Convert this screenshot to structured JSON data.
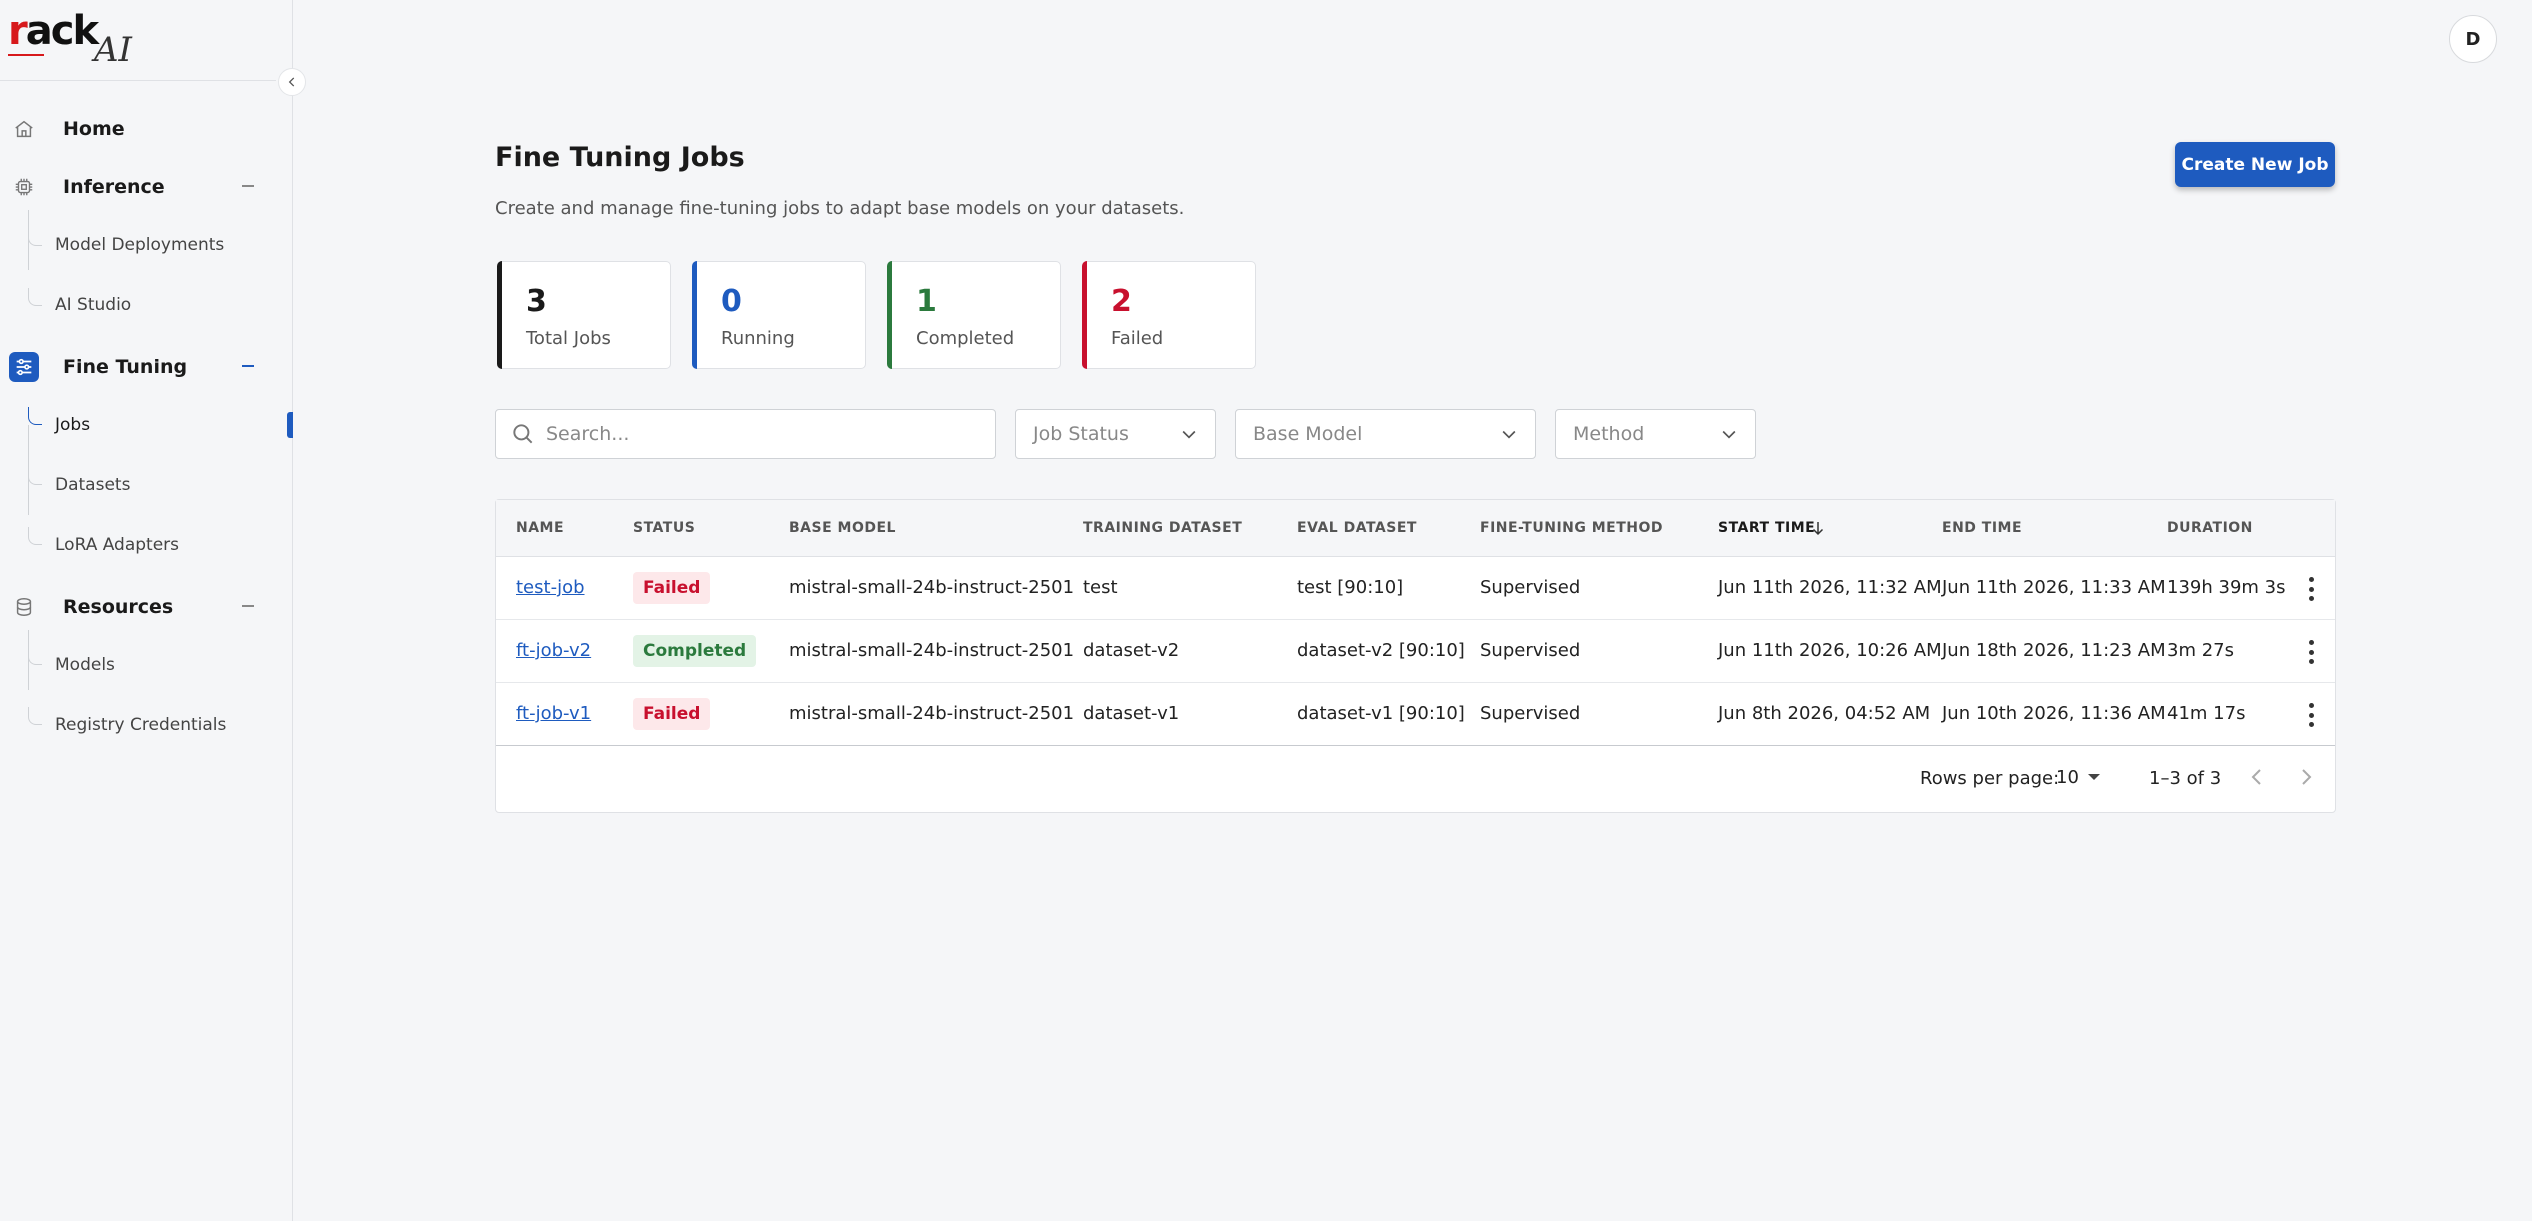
{
  "brand": {
    "logo_r": "r",
    "logo_rest": "ack",
    "logo_ai": "AI"
  },
  "sidebar": {
    "items": [
      {
        "label": "Home",
        "icon": "home-icon"
      },
      {
        "label": "Inference",
        "icon": "chip-icon",
        "children": [
          "Model Deployments",
          "AI Studio"
        ]
      },
      {
        "label": "Fine Tuning",
        "icon": "sliders-icon",
        "children": [
          "Jobs",
          "Datasets",
          "LoRA Adapters"
        ]
      },
      {
        "label": "Resources",
        "icon": "database-icon",
        "children": [
          "Models",
          "Registry Credentials"
        ]
      }
    ],
    "active_item": "Jobs"
  },
  "user": {
    "avatar_initial": "D"
  },
  "page": {
    "title": "Fine Tuning Jobs",
    "subtitle": "Create and manage fine-tuning jobs to adapt base models on your datasets.",
    "create_button": "Create New Job"
  },
  "stats": [
    {
      "value": "3",
      "label": "Total Jobs",
      "color": "#1a1a1a"
    },
    {
      "value": "0",
      "label": "Running",
      "color": "#1e5bbf"
    },
    {
      "value": "1",
      "label": "Completed",
      "color": "#2b7a3d"
    },
    {
      "value": "2",
      "label": "Failed",
      "color": "#c8102e"
    }
  ],
  "filters": {
    "search_placeholder": "Search...",
    "job_status": "Job Status",
    "base_model": "Base Model",
    "method": "Method"
  },
  "table": {
    "columns": [
      "NAME",
      "STATUS",
      "BASE MODEL",
      "TRAINING DATASET",
      "EVAL DATASET",
      "FINE-TUNING METHOD",
      "START TIME",
      "END TIME",
      "DURATION"
    ],
    "sorted_column": "START TIME",
    "rows": [
      {
        "name": "test-job",
        "status": "Failed",
        "base_model": "mistral-small-24b-instruct-2501",
        "training_dataset": "test",
        "eval_dataset": "test [90:10]",
        "method": "Supervised",
        "start_time": "Jun 11th 2026, 11:32 AM",
        "end_time": "Jun 11th 2026, 11:33 AM",
        "duration": "139h 39m 3s"
      },
      {
        "name": "ft-job-v2",
        "status": "Completed",
        "base_model": "mistral-small-24b-instruct-2501",
        "training_dataset": "dataset-v2",
        "eval_dataset": "dataset-v2 [90:10]",
        "method": "Supervised",
        "start_time": "Jun 11th 2026, 10:26 AM",
        "end_time": "Jun 18th 2026, 11:23 AM",
        "duration": "3m 27s"
      },
      {
        "name": "ft-job-v1",
        "status": "Failed",
        "base_model": "mistral-small-24b-instruct-2501",
        "training_dataset": "dataset-v1",
        "eval_dataset": "dataset-v1 [90:10]",
        "method": "Supervised",
        "start_time": "Jun 8th 2026, 04:52 AM",
        "end_time": "Jun 10th 2026, 11:36 AM",
        "duration": "41m 17s"
      }
    ],
    "footer": {
      "rows_per_page_label": "Rows per page:",
      "rows_per_page_value": "10",
      "range": "1–3 of 3"
    }
  }
}
